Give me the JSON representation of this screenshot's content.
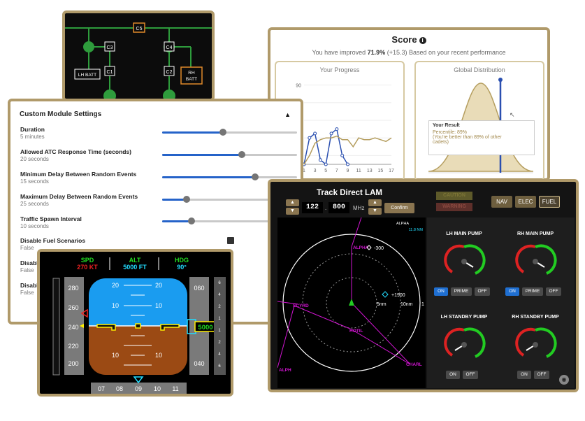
{
  "electrical": {
    "labels": [
      "C5",
      "C3",
      "C4",
      "C1",
      "C2"
    ],
    "lh_batt": "LH BATT",
    "rh_batt_line1": "RH",
    "rh_batt_line2": "BATT"
  },
  "score": {
    "title": "Score",
    "subtitle_prefix": "You have improved ",
    "improvement": "71.9%",
    "subtitle_suffix": " (+15.3) Based on your recent performance",
    "progress_title": "Your Progress",
    "distribution_title": "Global Distribution",
    "progress_chart": {
      "type": "line",
      "x_ticks": [
        "1",
        "3",
        "5",
        "7",
        "9",
        "11",
        "13",
        "15",
        "17"
      ],
      "y_ticks": [
        "10",
        "30",
        "50",
        "70",
        "90"
      ],
      "ylim": [
        0,
        100
      ],
      "series": [
        {
          "values": [
            0,
            30,
            35,
            5,
            0,
            35,
            40,
            10,
            0
          ]
        },
        {
          "values": [
            0,
            10,
            24,
            28,
            30,
            30,
            32,
            28,
            28,
            20,
            30,
            28,
            28,
            30,
            28,
            26,
            30
          ]
        }
      ]
    },
    "tooltip": {
      "heading": "Your Result",
      "line1": "Percentile: 89%",
      "line2": "(You're better than 89% of other",
      "line3": "cadets)"
    }
  },
  "settings": {
    "title": "Custom Module Settings",
    "caret": "▲",
    "items": [
      {
        "label": "Duration",
        "value": "5 minutes",
        "fill": 0.45
      },
      {
        "label": "Allowed ATC Response Time (seconds)",
        "value": "20 seconds",
        "fill": 0.59
      },
      {
        "label": "Minimum Delay Between Random Events",
        "value": "15 seconds",
        "fill": 0.69
      },
      {
        "label": "Maximum Delay Between Random Events",
        "value": "25 seconds",
        "fill": 0.18
      },
      {
        "label": "Traffic Spawn Interval",
        "value": "10 seconds",
        "fill": 0.22
      }
    ],
    "fuel_label": "Disable Fuel Scenarios",
    "fuel_value": "False",
    "disable_a": "Disable",
    "disable_a_value": "False",
    "disable_b": "Disable",
    "disable_b_value": "False"
  },
  "pfd": {
    "spd_label": "SPD",
    "spd_value": "270 KT",
    "alt_label": "ALT",
    "alt_value": "5000 FT",
    "hdg_label": "HDG",
    "hdg_value": "90°",
    "speed_ticks": [
      "280",
      "260",
      "240",
      "220",
      "200"
    ],
    "alt_ticks": [
      "060",
      "040"
    ],
    "alt_box": "5000",
    "pitch_labels": [
      "20",
      "20",
      "10",
      "10",
      "10",
      "10"
    ],
    "heading_ticks": [
      "07",
      "08",
      "09",
      "10",
      "11"
    ],
    "right_scale": [
      "6",
      "4",
      "2",
      "1",
      "1",
      "2",
      "4",
      "6"
    ]
  },
  "radar": {
    "title": "Track Direct LAM",
    "freq_whole": "122",
    "freq_decimal": "800",
    "unit": "MHz",
    "confirm": "Confirm",
    "caution": "CAUTION",
    "warning": "WARNING",
    "systems": [
      "NAV",
      "ELEC",
      "FUEL"
    ],
    "active_system": "FUEL",
    "waypoint_info": "ALPHA",
    "waypoint_dist": "11.8 NM",
    "waypoints": [
      "ALPHA",
      "SCYRD",
      "HOTIL",
      "CHARL",
      "ALPH"
    ],
    "traffic1_alt": "-300",
    "traffic2_alt": "+1900",
    "range_inner": "5nm",
    "range_outer": "10nm",
    "range_edge": "1"
  },
  "pumps": [
    {
      "label": "LH MAIN PUMP",
      "buttons": [
        "ON",
        "PRIME",
        "OFF"
      ]
    },
    {
      "label": "RH MAIN PUMP",
      "buttons": [
        "ON",
        "PRIME",
        "OFF"
      ]
    },
    {
      "label": "LH STANDBY PUMP",
      "buttons": [
        "ON",
        "OFF"
      ]
    },
    {
      "label": "RH STANDBY PUMP",
      "buttons": [
        "ON",
        "OFF"
      ]
    }
  ],
  "colors": {
    "gold_border": "#b09a6a",
    "slider_blue": "#2563c9",
    "sky": "#1a9cf0",
    "ground": "#9b4a14",
    "magenta": "#d014d0",
    "radar_green": "#22cc22"
  }
}
